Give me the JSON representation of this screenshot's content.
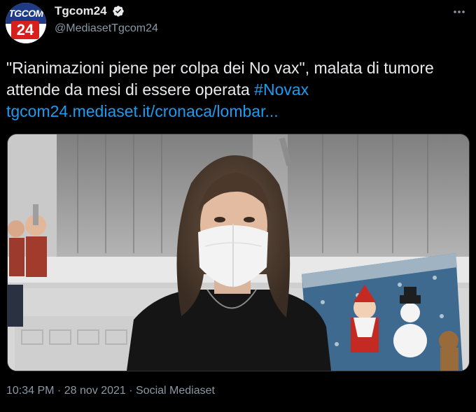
{
  "account": {
    "avatar_top_text": "TGCOM",
    "avatar_number": "24",
    "display_name": "Tgcom24",
    "handle": "@MediasetTgcom24",
    "verified": true
  },
  "tweet": {
    "text_main": "\"Rianimazioni piene per colpa dei No vax\", malata di tumore attende da mesi di essere operata ",
    "hashtag": "#Novax",
    "link": "tgcom24.mediaset.it/cronaca/lombar..."
  },
  "meta": {
    "time": "10:34 PM",
    "separator": " · ",
    "date": "28 nov 2021",
    "source": "Social Mediaset"
  },
  "colors": {
    "background": "#000000",
    "text": "#e7e9ea",
    "secondary_text": "#8b98a5",
    "link": "#1d9bf0",
    "brand_blue": "#1f3b86",
    "brand_red": "#d6201d"
  },
  "icons": {
    "verified": "verified-badge-icon",
    "more": "more-options-icon"
  }
}
